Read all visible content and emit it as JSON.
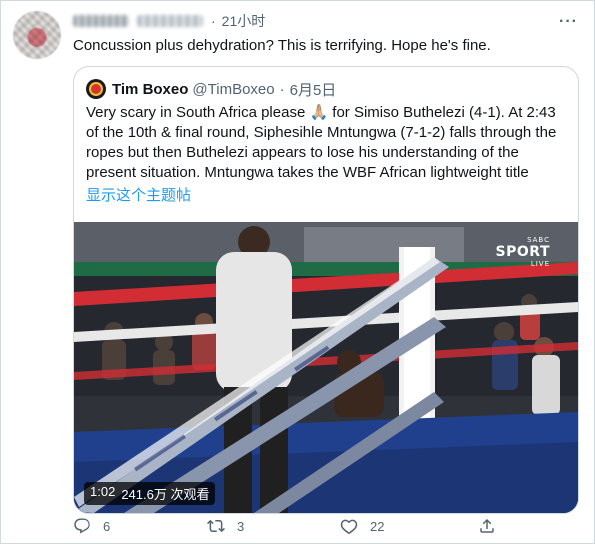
{
  "tweet": {
    "time": "21小时",
    "text": "Concussion plus dehydration? This is terrifying. Hope he's fine.",
    "more_icon": "more-horizontal-icon"
  },
  "quoted": {
    "name": "Tim Boxeo",
    "handle": "@TimBoxeo",
    "date": "6月5日",
    "text": "Very scary in South Africa please 🙏🏼 for Simiso Buthelezi (4-1). At 2:43 of the 10th & final round, Siphesihle Mntungwa (7-1-2) falls through the ropes but then Buthelezi appears to lose his understanding of the present situation. Mntungwa takes the WBF African lightweight title",
    "show_thread": "显示这个主题帖"
  },
  "video": {
    "duration": "1:02",
    "views": "241.6万 次观看",
    "broadcaster_top": "SABC",
    "broadcaster_main": "SPORT",
    "broadcaster_live": "LIVE"
  },
  "actions": {
    "replies": "6",
    "retweets": "3",
    "likes": "22"
  },
  "colors": {
    "link": "#1d9bf0",
    "secondary_text": "#536471",
    "border": "#cfd9de"
  }
}
